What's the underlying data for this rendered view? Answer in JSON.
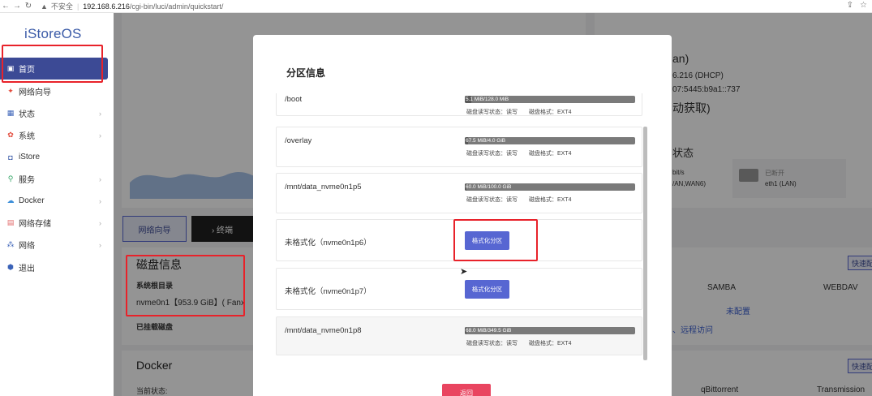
{
  "browser": {
    "not_secure": "不安全",
    "url_host": "192.168.6.216",
    "url_path": "/cgi-bin/luci/admin/quickstart/"
  },
  "sidebar": {
    "logo": "iStoreOS",
    "items": [
      {
        "label": "首页",
        "icon": "home-icon",
        "active": true,
        "color": "#ffffff"
      },
      {
        "label": "网络向导",
        "icon": "wand-icon",
        "color": "#e24a3b"
      },
      {
        "label": "状态",
        "icon": "grid-icon",
        "chevron": true,
        "color": "#3b63b8"
      },
      {
        "label": "系统",
        "icon": "gear-icon",
        "chevron": true,
        "color": "#e24a3b"
      },
      {
        "label": "iStore",
        "icon": "store-icon",
        "color": "#3b5ba8"
      },
      {
        "label": "服务",
        "icon": "service-icon",
        "chevron": true,
        "color": "#3aa86b"
      },
      {
        "label": "Docker",
        "icon": "docker-icon",
        "chevron": true,
        "color": "#3b8ed8"
      },
      {
        "label": "网络存储",
        "icon": "storage-icon",
        "chevron": true,
        "color": "#e26a6a"
      },
      {
        "label": "网络",
        "icon": "network-icon",
        "chevron": true,
        "color": "#3b63b8"
      },
      {
        "label": "退出",
        "icon": "logout-icon",
        "color": "#3b63b8"
      }
    ]
  },
  "background": {
    "wizard_button": "网络向导",
    "terminal_button": "› 终端",
    "disk_title": "磁盘信息",
    "root_label": "系统根目录",
    "root_value": "nvme0n1【953.9 GiB】( Fanx",
    "mounted_label": "已挂载磁盘",
    "docker_title": "Docker",
    "docker_status": "当前状态:",
    "right_fragment_1": "an)",
    "right_fragment_2": "6.216 (DHCP)",
    "right_fragment_3": "07:5445:b9a1::737",
    "right_fragment_4": "动获取)",
    "right_status": "状态",
    "right_speed": "bit/s",
    "right_ports": "/AN,WAN6)",
    "right_disconnected": "已断开",
    "right_eth1": "eth1 (LAN)",
    "quick_config": "快速配",
    "samba": "SAMBA",
    "webdav": "WEBDAV",
    "not_configured": "未配置",
    "remote_access": "、远程访问",
    "qbittorrent": "qBittorrent",
    "transmission": "Transmission"
  },
  "modal": {
    "title": "分区信息",
    "back_button": "返回",
    "partitions": [
      {
        "mount": "/boot",
        "usage": "5.1 MiB/128.0 MiB",
        "fraction": 0.04,
        "rw_label": "磁盘读写状态：读写",
        "fs_label": "磁盘格式：EXT4"
      },
      {
        "mount": "/overlay",
        "usage": "67.5 MiB/4.0 GiB",
        "fraction": 0.02,
        "rw_label": "磁盘读写状态：读写",
        "fs_label": "磁盘格式：EXT4"
      },
      {
        "mount": "/mnt/data_nvme0n1p5",
        "usage": "60.0 MiB/100.0 GiB",
        "fraction": 0.01,
        "rw_label": "磁盘读写状态：读写",
        "fs_label": "磁盘格式：EXT4"
      },
      {
        "mount": "未格式化（nvme0n1p6）",
        "format_button": "格式化分区"
      },
      {
        "mount": "未格式化（nvme0n1p7）",
        "format_button": "格式化分区"
      },
      {
        "mount": "/mnt/data_nvme0n1p8",
        "usage": "68.0 MiB/349.5 GiB",
        "fraction": 0.01,
        "rw_label": "磁盘读写状态：读写",
        "fs_label": "磁盘格式：EXT4"
      }
    ]
  }
}
